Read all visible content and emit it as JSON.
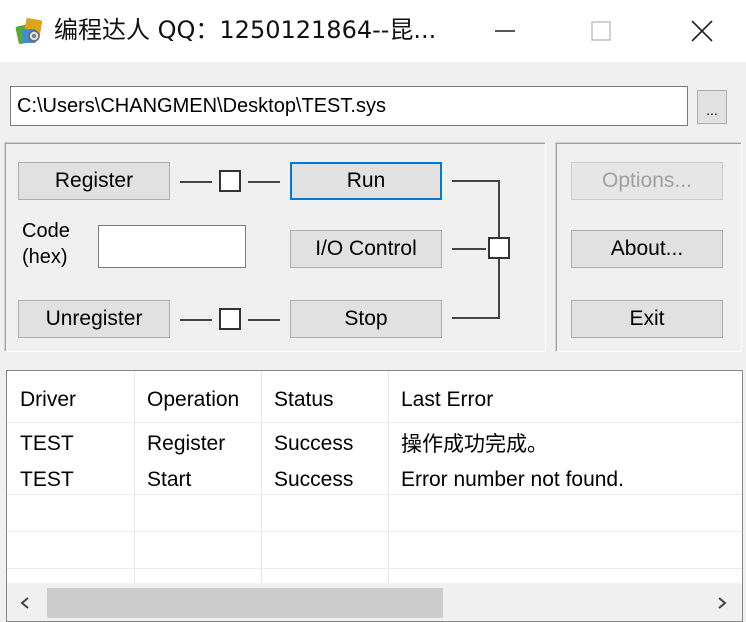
{
  "window": {
    "title": "编程达人 QQ：1250121864--昆...",
    "icon": "app-icon"
  },
  "path": {
    "value": "C:\\Users\\CHANGMEN\\Desktop\\TEST.sys",
    "browse_label": "..."
  },
  "controls": {
    "register_label": "Register",
    "unregister_label": "Unregister",
    "run_label": "Run",
    "io_control_label": "I/O Control",
    "stop_label": "Stop",
    "code_label_line1": "Code",
    "code_label_line2": "(hex)",
    "code_value": ""
  },
  "side_buttons": {
    "options_label": "Options...",
    "about_label": "About...",
    "exit_label": "Exit"
  },
  "list": {
    "columns": [
      "Driver",
      "Operation",
      "Status",
      "Last Error"
    ],
    "rows": [
      [
        "TEST",
        "Register",
        "Success",
        "操作成功完成。"
      ],
      [
        "TEST",
        "Start",
        "Success",
        "Error number not found."
      ]
    ]
  },
  "colors": {
    "accent_focus": "#0078d7",
    "background": "#f0f0f0",
    "disabled_text": "#a0a0a0"
  }
}
